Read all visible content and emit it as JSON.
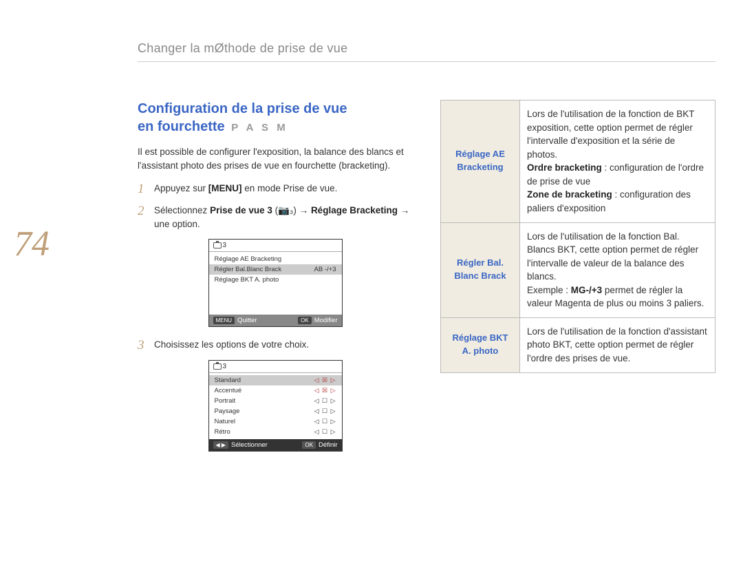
{
  "page_number": "74",
  "header": "Changer la mØthode de prise de vue",
  "section": {
    "title_line1": "Configuration de la prise de vue",
    "title_line2": "en fourchette",
    "modes": "P A S M",
    "intro": "Il est possible de configurer l'exposition, la balance des blancs et l'assistant photo des prises de vue en fourchette (bracketing).",
    "step1_num": "1",
    "step1_a": "Appuyez sur ",
    "step1_b": "[MENU]",
    "step1_c": " en mode Prise de vue.",
    "step2_num": "2",
    "step2_a": "Sélectionnez ",
    "step2_b": "Prise de vue 3",
    "step2_c": " (📷₃) → ",
    "step2_d": "Réglage Bracketing",
    "step2_e": " → une option.",
    "step3_num": "3",
    "step3_text": "Choisissez les options de votre choix."
  },
  "screen1": {
    "tab": "3",
    "row1": "Réglage AE Bracketing",
    "row2_l": "Régler Bal.Blanc Brack",
    "row2_r": "AB -/+3",
    "row3": "Réglage BKT A. photo",
    "footer_menu": "MENU",
    "footer_menu_txt": "Quitter",
    "footer_ok": "OK",
    "footer_ok_txt": "Modifier"
  },
  "screen2": {
    "tab": "3",
    "r1_l": "Standard",
    "r1_r": "◁ ☒ ▷",
    "r2_l": "Accentué",
    "r2_r": "◁ ☒ ▷",
    "r3_l": "Portrait",
    "r3_r": "◁ ☐ ▷",
    "r4_l": "Paysage",
    "r4_r": "◁ ☐ ▷",
    "r5_l": "Naturel",
    "r5_r": "◁ ☐ ▷",
    "r6_l": "Rétro",
    "r6_r": "◁ ☐ ▷",
    "footer_sel_btn": "◀ ▶",
    "footer_sel_txt": "Sélectionner",
    "footer_ok": "OK",
    "footer_ok_txt": "Définir"
  },
  "table": {
    "r1_label": "Réglage AE Bracketing",
    "r1_p1": "Lors de l'utilisation de la fonction de BKT exposition, cette option permet de régler l'intervalle d'exposition et la série de photos.",
    "r1_b1": "Ordre bracketing",
    "r1_b1t": " : configuration de l'ordre de prise de vue",
    "r1_b2": "Zone de bracketing",
    "r1_b2t": " : configuration des paliers d'exposition",
    "r2_label": "Régler Bal. Blanc Brack",
    "r2_p1": "Lors de l'utilisation de la fonction Bal. Blancs BKT, cette option permet de régler l'intervalle de valeur de la balance des blancs.",
    "r2_p2a": "Exemple : ",
    "r2_p2b": "MG-/+3",
    "r2_p2c": " permet de régler la valeur Magenta de plus ou moins 3 paliers.",
    "r3_label": "Réglage BKT A. photo",
    "r3_text": "Lors de l'utilisation de la fonction d'assistant photo BKT, cette option permet de régler l'ordre des prises de vue."
  }
}
